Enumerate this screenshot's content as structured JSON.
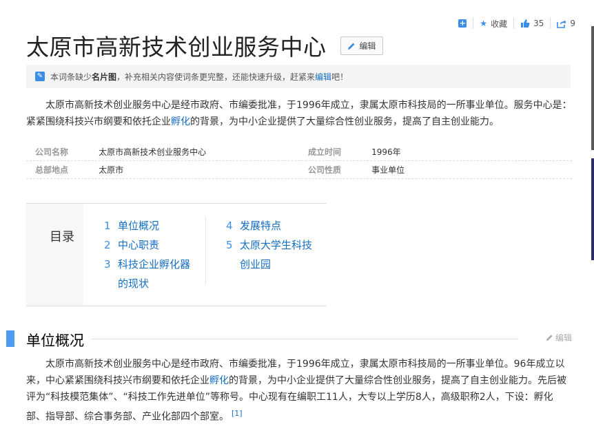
{
  "actions": {
    "favorite_label": "收藏",
    "like_count": "35",
    "share_count": "9"
  },
  "title": "太原市高新技术创业服务中心",
  "edit_label": "编辑",
  "notice": {
    "prefix": "本词条缺少",
    "bold": "名片图",
    "middle": "，补充相关内容使词条更完整，还能快速升级，赶紧来",
    "link": "编辑",
    "suffix": "吧！"
  },
  "summary": {
    "text1": "太原市高新技术创业服务中心是经市政府、市编委批准，于1996年成立，隶属太原市科技局的一所事业单位。服务中心是：紧紧围绕科技兴市纲要和依托企业",
    "link": "孵化",
    "text2": "的背景，为中小企业提供了大量综合性创业服务，提高了自主创业能力。"
  },
  "basic_info": [
    {
      "k1": "公司名称",
      "v1": "太原市高新技术创业服务中心",
      "k2": "成立时间",
      "v2": "1996年"
    },
    {
      "k1": "总部地点",
      "v1": "太原市",
      "k2": "公司性质",
      "v2": "事业单位"
    }
  ],
  "toc": {
    "title": "目录",
    "items": [
      {
        "num": "1",
        "label": "单位概况"
      },
      {
        "num": "2",
        "label": "中心职责"
      },
      {
        "num": "3",
        "label": "科技企业孵化器的现状"
      },
      {
        "num": "4",
        "label": "发展特点"
      },
      {
        "num": "5",
        "label": "太原大学生科技创业园"
      }
    ]
  },
  "section1": {
    "heading": "单位概况",
    "edit": "编辑",
    "text1": "太原市高新技术创业服务中心是经市政府、市编委批准，于1996年成立，隶属太原市科技局的一所事业单位。96年成立以来，中心紧紧围绕科技兴市纲要和依托企业",
    "link": "孵化",
    "text2": "的背景，为中小企业提供了大量综合性创业服务，提高了自主创业能力。先后被评为“科技模范集体”、“科技工作先进单位”等称号。中心现有在编职工11人，大专以上学历8人，高级职称2人，下设：孵化部、指导部、综合事务部、产业化部四个部室。",
    "ref": "[1]"
  },
  "colors": {
    "accent": "#3a8ee6",
    "link": "#136ec2",
    "section_bar": "#4f9cee"
  }
}
